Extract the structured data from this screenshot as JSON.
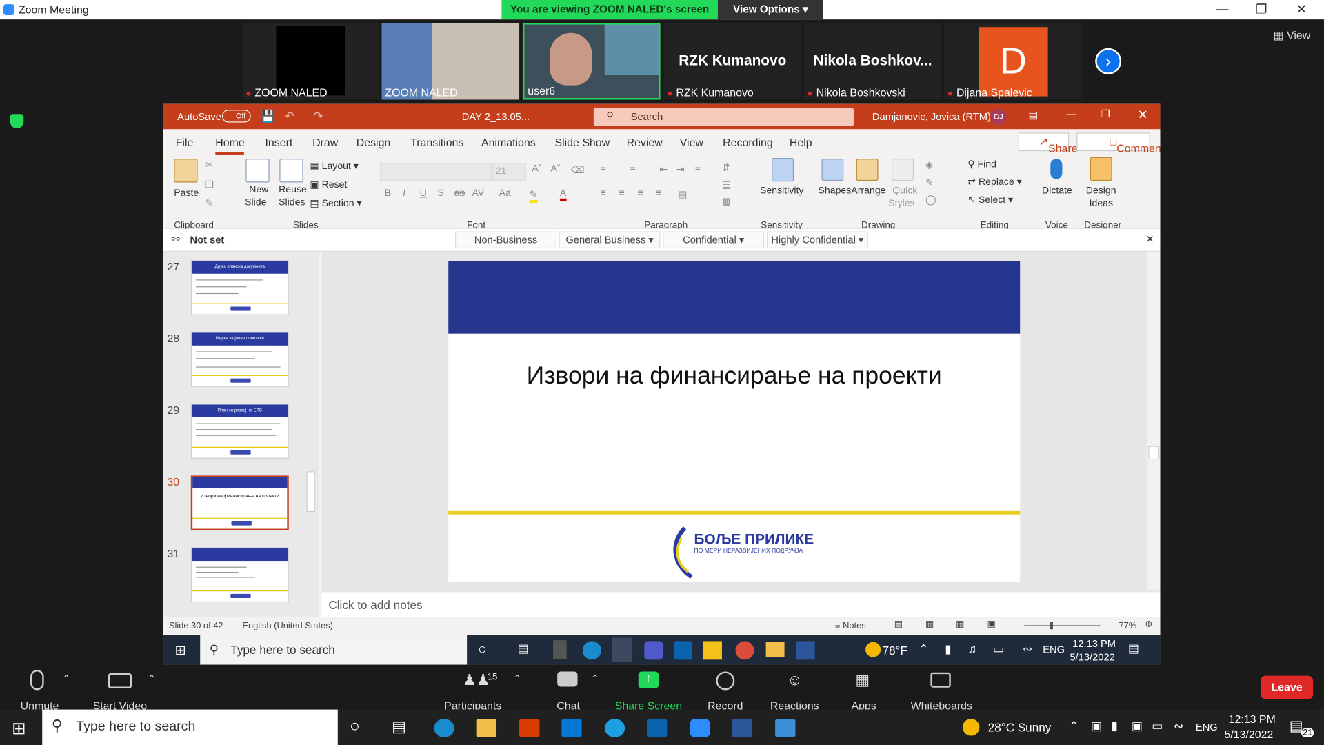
{
  "zoom_title": "Zoom Meeting",
  "banner": "You are viewing ZOOM NALED's screen",
  "view_options": "View Options",
  "view_button": "View",
  "participants": [
    {
      "name": "ZOOM NALED",
      "big": ""
    },
    {
      "name": "ZOOM NALED",
      "big": ""
    },
    {
      "name": "user6",
      "big": ""
    },
    {
      "name": "RZK Kumanovo",
      "big": "RZK Kumanovo"
    },
    {
      "name": "Nikola Boshkovski",
      "big": "Nikola  Boshkov..."
    },
    {
      "name": "Dijana Spalevic",
      "big": "D"
    }
  ],
  "ppt": {
    "autosave": "AutoSave",
    "autosave_state": "Off",
    "file_name": "DAY 2_13.05...",
    "search": "Search",
    "user": "Damjanovic, Jovica (RTM)",
    "user_initials": "DJ",
    "tabs": [
      "File",
      "Home",
      "Insert",
      "Draw",
      "Design",
      "Transitions",
      "Animations",
      "Slide Show",
      "Review",
      "View",
      "Recording",
      "Help"
    ],
    "share": "Share",
    "comments": "Comments",
    "ribbon": {
      "paste": "Paste",
      "new": "New",
      "slide": "Slide",
      "reuse": "Reuse",
      "slides_label": "Slides",
      "layout": "Layout",
      "reset": "Reset",
      "section": "Section",
      "font_size": "21",
      "sensitivity": "Sensitivity",
      "shapes": "Shapes",
      "arrange": "Arrange",
      "quick": "Quick",
      "styles": "Styles",
      "find": "Find",
      "replace": "Replace",
      "select": "Select",
      "dictate": "Dictate",
      "design": "Design",
      "ideas": "Ideas",
      "groups": [
        "Clipboard",
        "Slides",
        "Font",
        "Paragraph",
        "Sensitivity",
        "Drawing",
        "Editing",
        "Voice",
        "Designer"
      ]
    },
    "sensitivity_bar": {
      "notset": "Not set",
      "options": [
        "Non-Business",
        "General Business",
        "Confidential",
        "Highly Confidential"
      ]
    },
    "thumbs": [
      {
        "num": "27",
        "title": "Друга планска документа"
      },
      {
        "num": "28",
        "title": "Мерке за јавне политике"
      },
      {
        "num": "29",
        "title": "План за развој на ЕЛС"
      },
      {
        "num": "30",
        "title": "Извори на финансирање на проекти"
      },
      {
        "num": "31",
        "title": ""
      }
    ],
    "slide_title": "Извори на финансирање на проекти",
    "logo_main": "БОЉЕ ПРИЛИКЕ",
    "logo_sub": "ПО МЕРИ НЕРАЗВИЈЕНИХ ПОДРУЧЈА",
    "notes_placeholder": "Click to add notes",
    "status_slide": "Slide 30 of 42",
    "status_lang": "English (United States)",
    "status_notes": "Notes",
    "zoom": "77%",
    "inner_taskbar": {
      "search": "Type here to search",
      "temp": "78°F",
      "lang": "ENG",
      "time": "12:13 PM",
      "date": "5/13/2022"
    }
  },
  "zoom_toolbar": {
    "unmute": "Unmute",
    "start_video": "Start Video",
    "participants": "Participants",
    "participants_count": "15",
    "chat": "Chat",
    "share": "Share Screen",
    "record": "Record",
    "reactions": "Reactions",
    "apps": "Apps",
    "whiteboards": "Whiteboards",
    "leave": "Leave"
  },
  "taskbar": {
    "search": "Type here to search",
    "weather": "28°C  Sunny",
    "lang": "ENG",
    "time": "12:13 PM",
    "date": "5/13/2022",
    "notif": "21"
  }
}
